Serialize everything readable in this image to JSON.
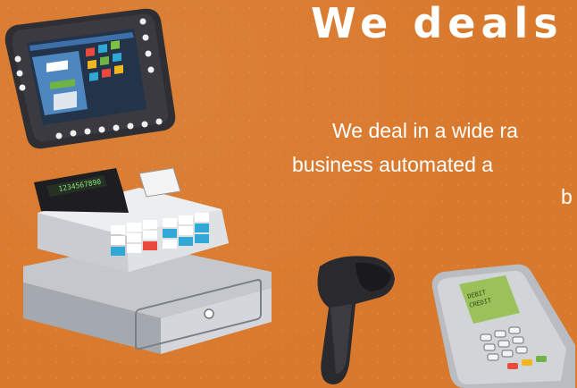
{
  "headline": "We deals",
  "description": {
    "line1": "We deal in a wide ra",
    "line2": "business automated a",
    "line3": "b"
  },
  "cash_register": {
    "display_digits": "1234567890"
  },
  "card_terminal": {
    "screen_text_1": "DEBIT",
    "screen_text_2": "CREDIT"
  },
  "colors": {
    "background": "#d9792d",
    "text": "#ffffff"
  },
  "icons": [
    "tablet-pos-icon",
    "cash-register-icon",
    "barcode-scanner-icon",
    "card-terminal-icon"
  ]
}
